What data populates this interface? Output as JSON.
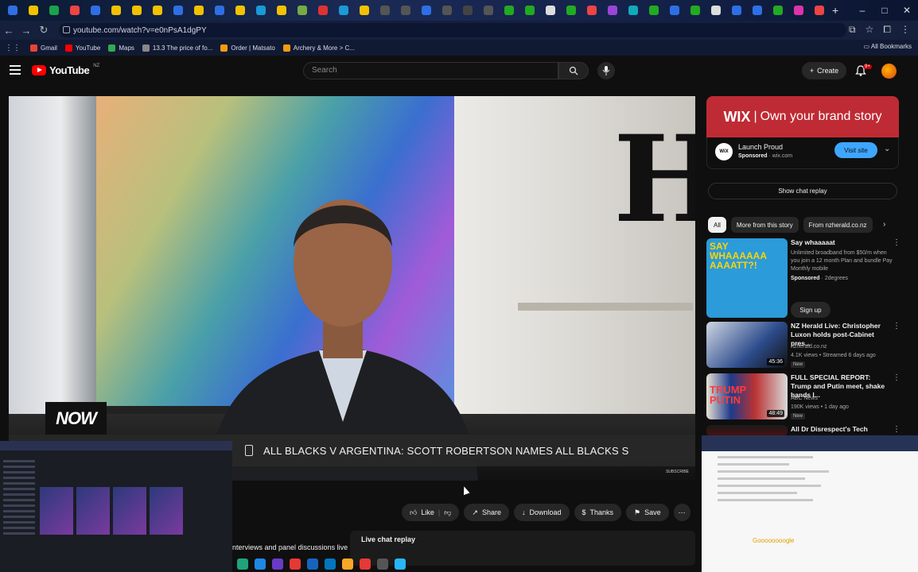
{
  "browser": {
    "tab_colors": [
      "#2f6fe4",
      "#f2c200",
      "#1aa34a",
      "#e44",
      "#2f6fe4",
      "#f2c200",
      "#f2c200",
      "#f2c200",
      "#2f6fe4",
      "#f2c200",
      "#2f6fe4",
      "#f2c200",
      "#1a9ad6",
      "#f2c200",
      "#7a4",
      "#d33",
      "#1a9ad6",
      "#f2c200",
      "#555",
      "#555",
      "#2f6fe4",
      "#555",
      "#444",
      "#555",
      "#2a2",
      "#2a2",
      "#ddd",
      "#2a2",
      "#e44",
      "#9b45d8",
      "#1ab",
      "#2a2",
      "#2f6fe4",
      "#2a2",
      "#ddd",
      "#2f6fe4",
      "#2f6fe4",
      "#2a2",
      "#d3a",
      "#e44"
    ],
    "new_tab": "+",
    "window_controls": [
      "–",
      "□",
      "✕"
    ],
    "url": "youtube.com/watch?v=e0nPsA1dgPY",
    "bookmarks": [
      {
        "label": "Gmail",
        "color": "#ea4335"
      },
      {
        "label": "YouTube",
        "color": "#ff0000"
      },
      {
        "label": "Maps",
        "color": "#34a853"
      },
      {
        "label": "13.3 The price of fo...",
        "color": "#888"
      },
      {
        "label": "Order | Matsato",
        "color": "#f39c12"
      },
      {
        "label": "Archery & More > C...",
        "color": "#f39c12"
      }
    ],
    "all_bookmarks": "All Bookmarks"
  },
  "youtube": {
    "logo_text": "YouTube",
    "region": "NZ",
    "search_placeholder": "Search",
    "create_label": "Create",
    "notif_count": "9+"
  },
  "video": {
    "now_badge": "NOW",
    "ticker": "ALL BLACKS V ARGENTINA: SCOTT ROBERTSON NAMES ALL BLACKS S",
    "subscribe": "SUBSCRIBE",
    "gothic_letter": "H"
  },
  "actions": {
    "like": "Like",
    "share": "Share",
    "download": "Download",
    "thanks": "Thanks",
    "save": "Save",
    "more": "⋯"
  },
  "description_snippet": "nterviews and panel discussions live",
  "live_chat": "Live chat replay",
  "ad": {
    "banner_brand": "WIX",
    "banner_text": "Own your brand story",
    "title": "Launch Proud",
    "sponsored": "Sponsored",
    "domain": "wix.com",
    "visit": "Visit site",
    "logo_text": "WiX"
  },
  "show_chat_replay": "Show chat replay",
  "chips": [
    "All",
    "More from this story",
    "From nzherald.co.nz"
  ],
  "recommendations": {
    "ad": {
      "thumb_text": "SAY WHAAAAAA AAAATT?!",
      "title": "Say whaaaaat",
      "desc": "Unlimited broadband from $50/m when you join a 12 month Plan and bundle Pay Monthly mobile",
      "sponsored": "Sponsored",
      "advertiser": "2degrees",
      "cta": "Sign up"
    },
    "items": [
      {
        "title": "NZ Herald Live: Christopher Luxon holds post-Cabinet pres...",
        "channel": "nzherald.co.nz",
        "stats": "4.1K views • Streamed 6 days ago",
        "badge": "New",
        "duration": "45:36"
      },
      {
        "title": "FULL SPECIAL REPORT: Trump and Putin meet, shake hands l...",
        "channel": "ABC News",
        "stats": "190K views • 1 day ago",
        "badge": "New",
        "duration": "48:49",
        "thumb_line1": "TRUMP",
        "thumb_line2": "PUTIN"
      },
      {
        "title": "All Dr Disrespect's Tech Issues",
        "channel": "",
        "stats": "",
        "badge": "",
        "duration": ""
      }
    ]
  },
  "overlay_logo": "Goooooooogle"
}
